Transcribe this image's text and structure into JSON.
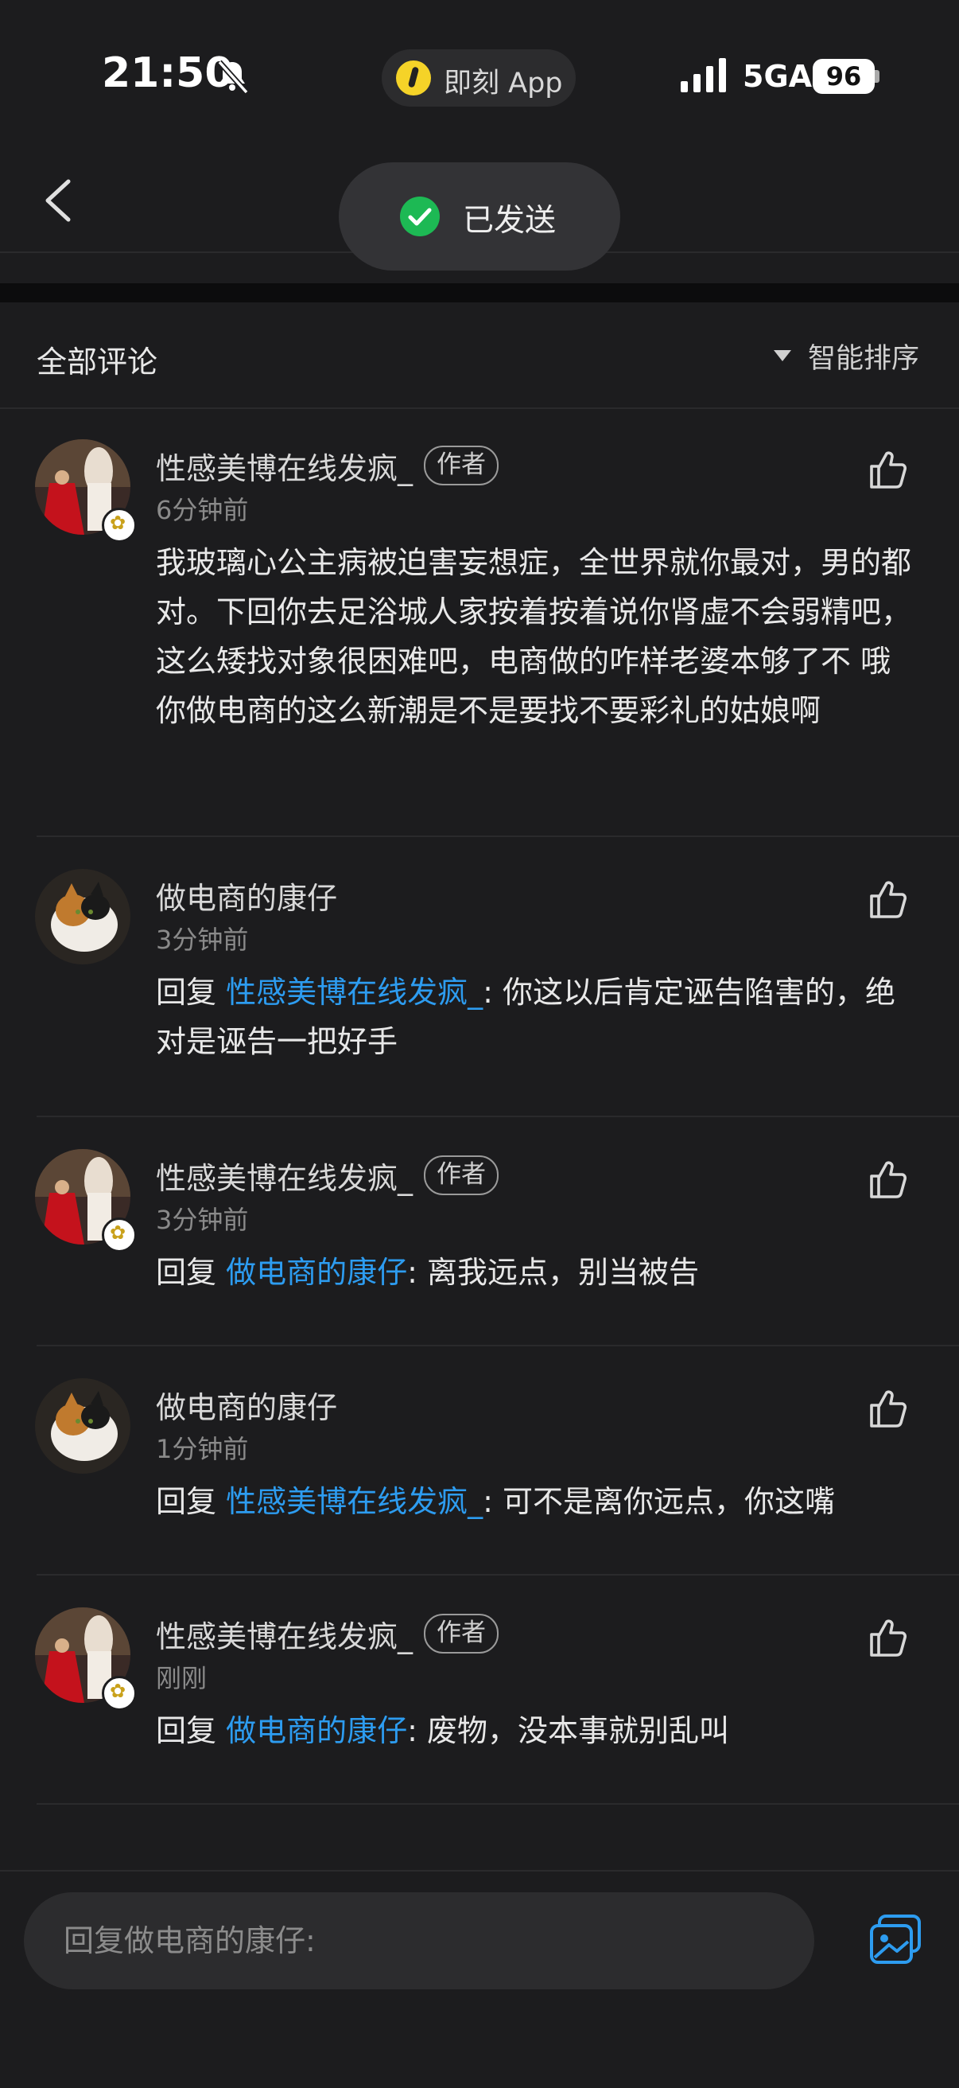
{
  "status_bar": {
    "time": "21:50",
    "app_name": "即刻 App",
    "network": "5GA",
    "battery": "96"
  },
  "toast": {
    "text": "已发送"
  },
  "comments_header": {
    "title": "全部评论",
    "sort_label": "智能排序"
  },
  "comments": [
    {
      "author": "性感美博在线发疯_",
      "tag": "作者",
      "time": "6分钟前",
      "text": "我玻璃心公主病被迫害妄想症，全世界就你最对，男的都对。下回你去足浴城人家按着按着说你肾虚不会弱精吧，这么矮找对象很困难吧，电商做的咋样老婆本够了不 哦你做电商的这么新潮是不是要找不要彩礼的姑娘啊"
    },
    {
      "author": "做电商的康仔",
      "time": "3分钟前",
      "reply_prefix": "回复 ",
      "mention": "性感美博在线发疯_",
      "text": ": 你这以后肯定诬告陷害的，绝对是诬告一把好手"
    },
    {
      "author": "性感美博在线发疯_",
      "tag": "作者",
      "time": "3分钟前",
      "reply_prefix": "回复 ",
      "mention": "做电商的康仔",
      "text": ": 离我远点，别当被告"
    },
    {
      "author": "做电商的康仔",
      "time": "1分钟前",
      "reply_prefix": "回复 ",
      "mention": "性感美博在线发疯_",
      "text": ": 可不是离你远点，你这嘴"
    },
    {
      "author": "性感美博在线发疯_",
      "tag": "作者",
      "time": "刚刚",
      "reply_prefix": "回复 ",
      "mention": "做电商的康仔",
      "text": ": 废物，没本事就别乱叫"
    }
  ],
  "input": {
    "placeholder": "回复做电商的康仔:"
  },
  "icons": {
    "back": "chevron-left-icon",
    "like": "thumbs-up-icon",
    "image": "image-picker-icon",
    "toast": "check-circle-icon",
    "sort": "triangle-down-icon"
  },
  "colors": {
    "background": "#1c1c1e",
    "mention": "#2d9cf0",
    "toast_check": "#1db954",
    "image_icon": "#2d9cf0"
  }
}
